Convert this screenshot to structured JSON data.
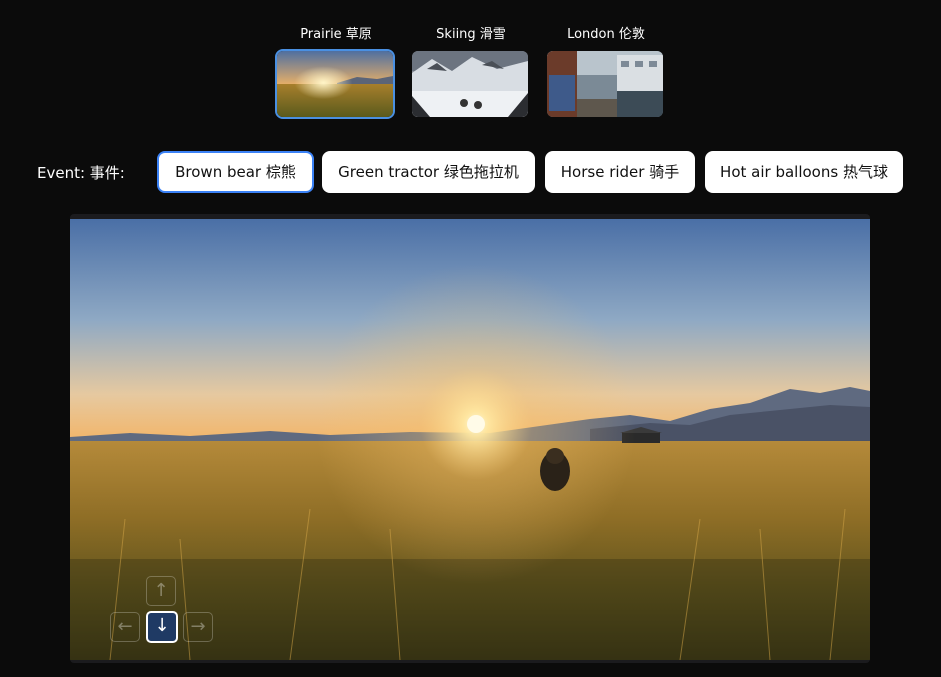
{
  "scenes": [
    {
      "label": "Prairie  草原",
      "active": true
    },
    {
      "label": "Skiing  滑雪",
      "active": false
    },
    {
      "label": "London  伦敦",
      "active": false
    }
  ],
  "event_label": "Event:  事件:",
  "events": [
    {
      "label": "Brown bear  棕熊",
      "active": true
    },
    {
      "label": "Green tractor  绿色拖拉机",
      "active": false
    },
    {
      "label": "Horse rider  骑手",
      "active": false
    },
    {
      "label": "Hot air balloons  热气球",
      "active": false
    }
  ],
  "controls": {
    "up": "↑",
    "left": "←",
    "down": "↓",
    "right": "→",
    "active": "down"
  }
}
